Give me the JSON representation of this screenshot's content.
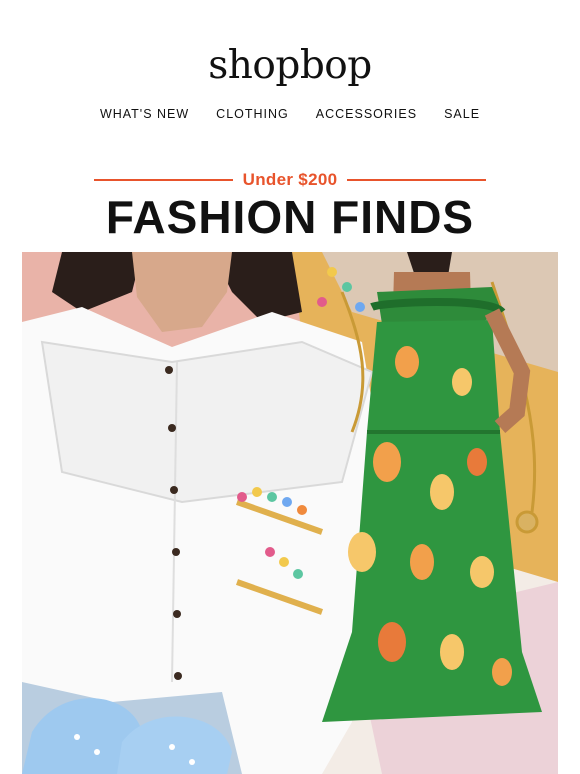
{
  "brand": {
    "logo": "shopbop"
  },
  "nav": {
    "items": [
      "WHAT'S NEW",
      "CLOTHING",
      "ACCESSORIES",
      "SALE"
    ]
  },
  "promo": {
    "eyebrow": "Under $200",
    "headline": "FASHION FINDS",
    "accent_color": "#e8542c"
  },
  "hero": {
    "products": [
      "white ruffle-collar blouse",
      "green tropical fruit print dress",
      "beaded hair clips",
      "gold chain necklace",
      "blue slide sandals"
    ]
  }
}
